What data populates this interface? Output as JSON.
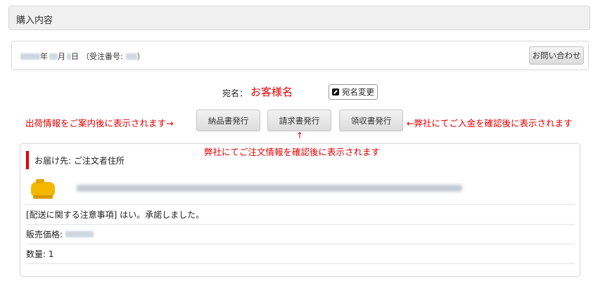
{
  "section": {
    "title": "購入内容"
  },
  "order": {
    "year_suffix": "年",
    "month_suffix": "月",
    "day_suffix": "日",
    "order_no_label": "（受注番号:",
    "order_no_close": "）",
    "inquiry_button": "お問い合わせ"
  },
  "recipient": {
    "label": "宛名：",
    "name": "お客様名",
    "change_button": "宛名変更"
  },
  "documents": {
    "delivery_note_button": "納品書発行",
    "invoice_button": "請求書発行",
    "receipt_button": "領収書発行"
  },
  "notes": {
    "left": "出荷情報をご案内後に表示されます→",
    "right": "←弊社にてご入金を確認後に表示されます",
    "arrow": "↑",
    "center": "弊社にてご注文情報を確認後に表示されます"
  },
  "details": {
    "destination": "お届け先: ご注文者住所",
    "product_icon": "yellow-tank-icon",
    "delivery_notice": "[配送に関する注意事項] はい。承諾しました。",
    "price_label": "販売価格:",
    "quantity_label": "数量: 1"
  },
  "colors": {
    "accent_red": "#e00000",
    "product_yellow": "#f5b800"
  }
}
